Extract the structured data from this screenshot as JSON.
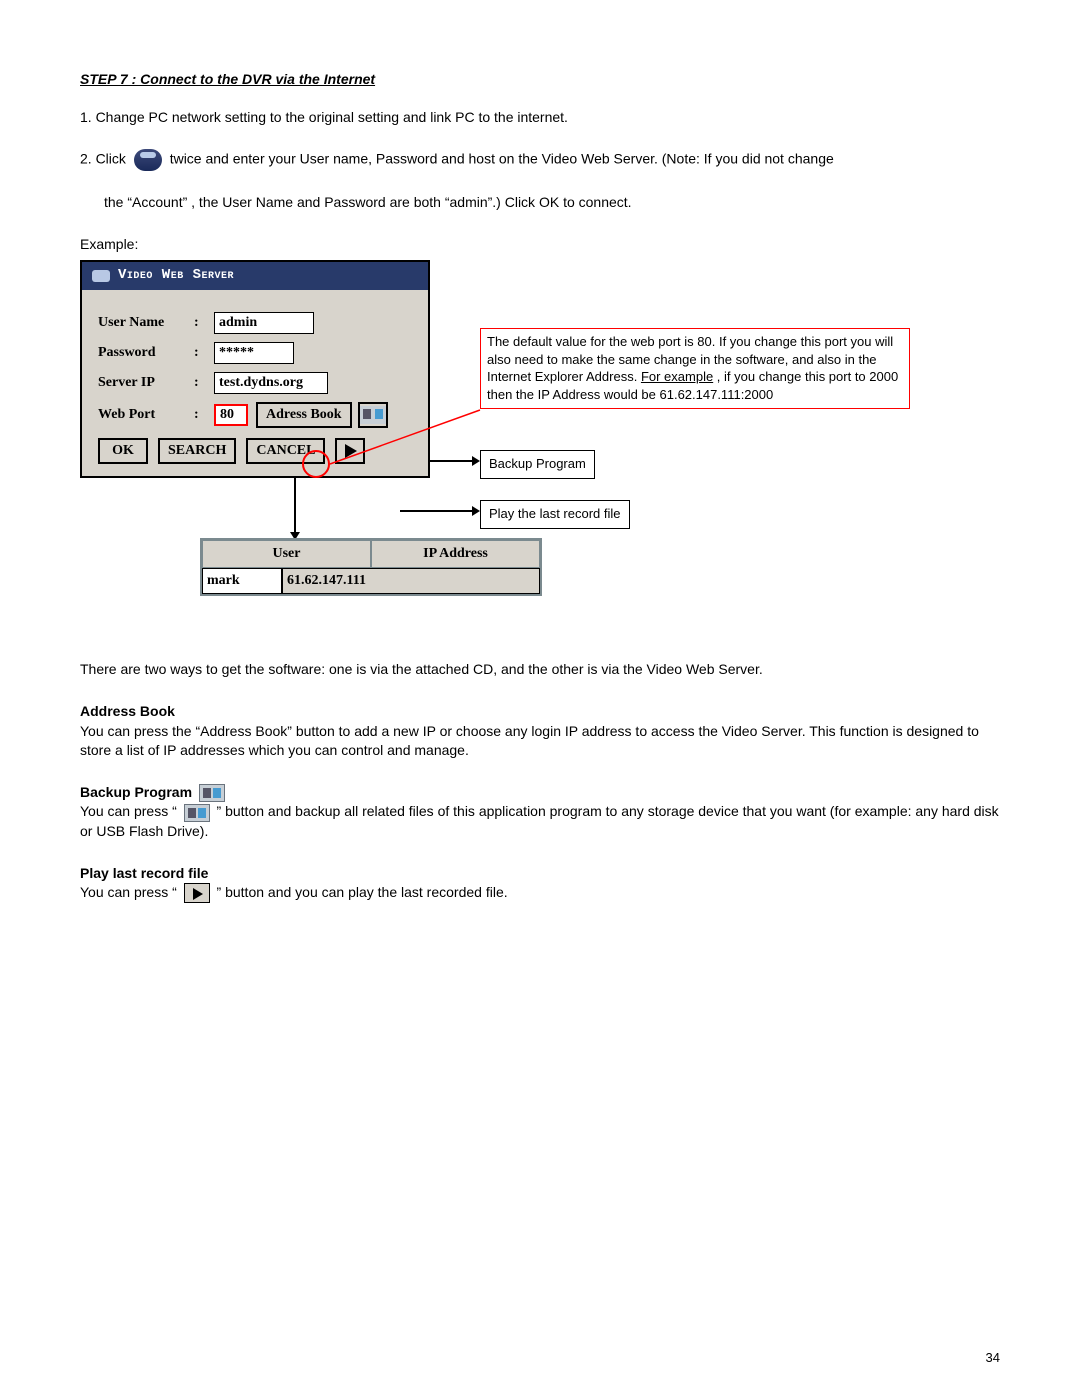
{
  "step_heading": "STEP 7 : Connect to the DVR via the Internet",
  "instructions": {
    "i1": "1. Change PC network setting to the original setting and link PC to the internet.",
    "i2_pre": "2. Click",
    "i2_post": "twice and enter your User name, Password and host on the Video Web Server. (Note: If you did not change",
    "i2_line2": "the “Account” , the User Name and Password are both “admin”.) Click OK to connect."
  },
  "example_label": "Example:",
  "dialog": {
    "title": "Video Web Server",
    "labels": {
      "user": "User Name",
      "pass": "Password",
      "ip": "Server IP",
      "port": "Web Port"
    },
    "values": {
      "user": "admin",
      "pass": "*****",
      "ip": "test.dydns.org",
      "port": "80"
    },
    "buttons": {
      "ok": "OK",
      "search": "SEARCH",
      "cancel": "CANCEL",
      "addrbook": "Adress Book"
    }
  },
  "note": {
    "l1": "The default value for the web port is 80. If you change this port you will also need to make the same change in the software, and also in the Internet Explorer Address.",
    "l2_u": "For example",
    "l2_rest": " , if you change this port to 2000 then the IP Address would be 61.62.147.111:2000"
  },
  "callouts": {
    "backup": "Backup Program",
    "play": "Play the last record file"
  },
  "addrbook": {
    "h_user": "User",
    "h_ip": "IP Address",
    "r_user": "mark",
    "r_ip": "61.62.147.111"
  },
  "below_text": "There are two ways to get the software:  one is via the attached CD, and the other is via the Video Web Server.",
  "sections": {
    "ab_h": "Address Book",
    "ab_t": "You can press the “Address Book” button to add a new IP or choose any login IP address to access the Video Server. This function is designed to store a list of IP addresses which you can control and manage.",
    "bk_h": "Backup Program",
    "bk_pre": "You can press “",
    "bk_post": "” button and backup all related files of this application program to any storage device that you want (for example: any hard disk or USB Flash Drive).",
    "pl_h": "Play last record file",
    "pl_pre": "You can press “",
    "pl_post": "” button and you can play the last recorded file."
  },
  "page_number": "34"
}
